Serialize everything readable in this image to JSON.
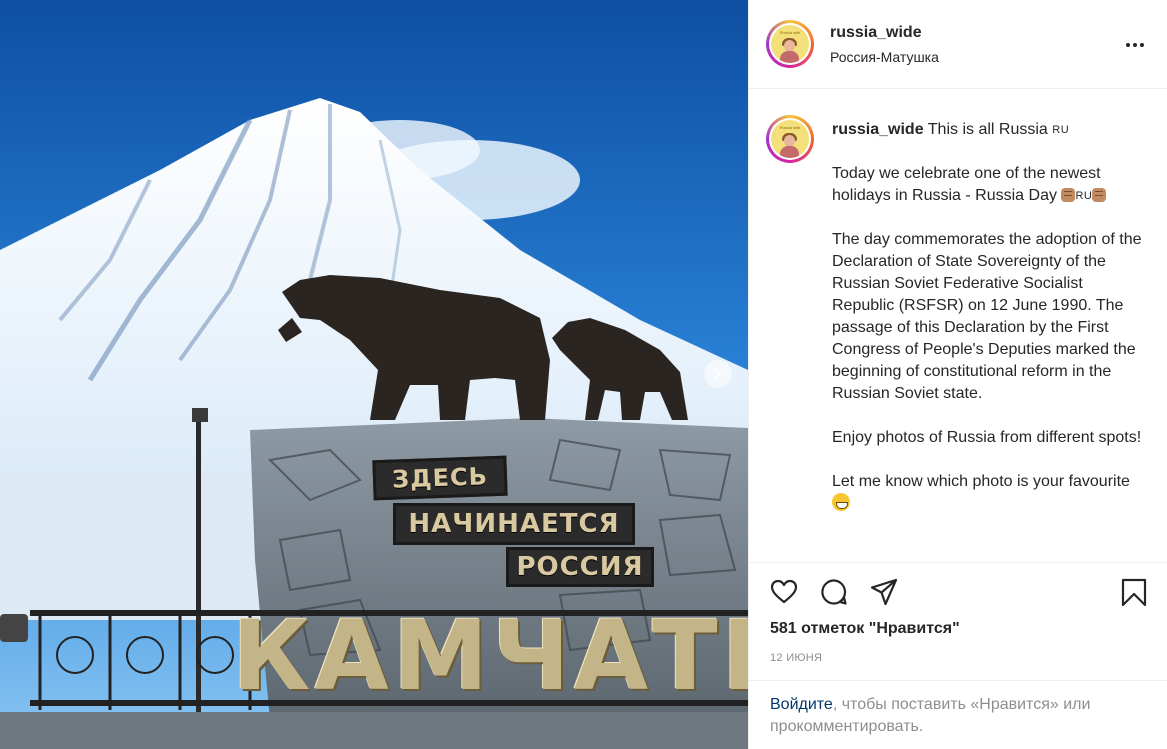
{
  "post": {
    "username": "russia_wide",
    "location": "Россия-Матушка",
    "avatar_tag": "Russia with Yulenka"
  },
  "photo": {
    "sign_line_1": "ЗДЕСЬ",
    "sign_line_2": "НАЧИНАЕТСЯ",
    "sign_line_3": "РОССИЯ",
    "ground_word": "КАМЧАТК"
  },
  "caption": {
    "username": "russia_wide",
    "title": "This is all Russia",
    "flag_code": "RU",
    "p1": "Today we celebrate one of the newest holidays in Russia - Russia Day",
    "p2": "The day commemorates the adoption of the Declaration of State Sovereignty of the Russian Soviet Federative Socialist Republic (RSFSR) on 12 June 1990. The passage of this Declaration by the First Congress of People's Deputies marked the beginning of constitutional reform in the Russian Soviet state.",
    "p3": "Enjoy photos of Russia from different spots!",
    "p4": "Let me know which photo is your favourite"
  },
  "stats": {
    "likes": "581 отметок \"Нравится\"",
    "date": "12 ИЮНЯ"
  },
  "login": {
    "link": "Войдите",
    "rest": ", чтобы поставить «Нравится» или прокомментировать."
  },
  "icons": [
    "heart-icon",
    "comment-icon",
    "share-icon",
    "bookmark-icon",
    "more-icon",
    "chevron-right-icon"
  ],
  "colors": {
    "link": "#00376b",
    "muted": "#8e8e8e",
    "text": "#262626",
    "sky": "#1c6fc4"
  }
}
